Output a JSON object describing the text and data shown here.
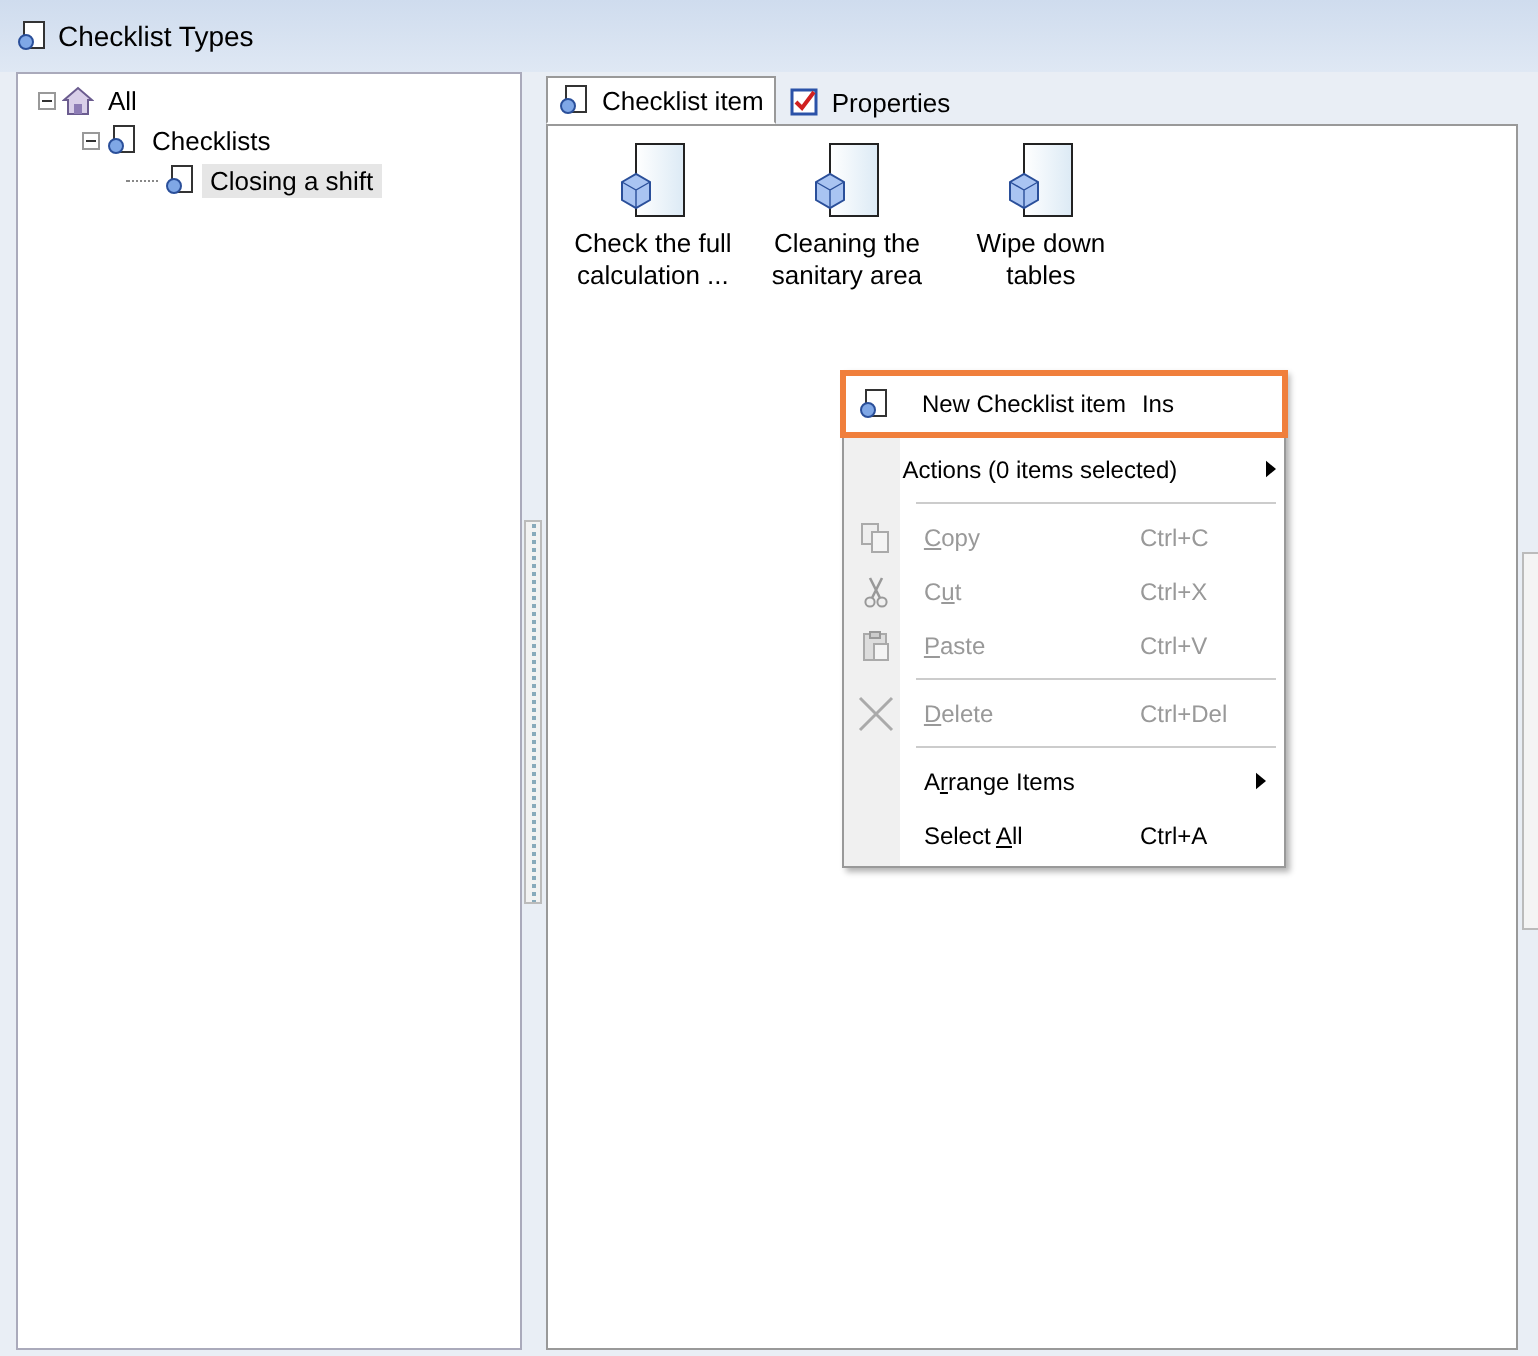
{
  "window": {
    "title": "Checklist Types"
  },
  "tree": [
    {
      "label": "All",
      "kind": "root",
      "selected": false,
      "expanded": true,
      "children": [
        {
          "label": "Checklists",
          "kind": "node",
          "selected": false,
          "expanded": true,
          "children": [
            {
              "label": "Closing a shift",
              "kind": "node",
              "selected": true
            }
          ]
        }
      ]
    }
  ],
  "tabs": [
    {
      "label": "Checklist item",
      "selected": true
    },
    {
      "label": "Properties",
      "selected": false
    }
  ],
  "items": [
    {
      "label": "Check the full calculation ..."
    },
    {
      "label": "Cleaning the sanitary area"
    },
    {
      "label": "Wipe down tables"
    }
  ],
  "context_menu": [
    {
      "kind": "item",
      "before": "New Checklist item",
      "shortcut": "Ins",
      "disabled": false,
      "submenu": false,
      "highlighted": true
    },
    {
      "kind": "item",
      "before": "Actions (0 items selected)",
      "disabled": false,
      "submenu": true,
      "highlighted": false
    },
    {
      "kind": "separator"
    },
    {
      "kind": "item",
      "key": "C",
      "after": "opy",
      "shortcut": "Ctrl+C",
      "disabled": true,
      "submenu": false,
      "highlighted": false
    },
    {
      "kind": "item",
      "before": "C",
      "key": "u",
      "after": "t",
      "shortcut": "Ctrl+X",
      "disabled": true,
      "submenu": false,
      "highlighted": false
    },
    {
      "kind": "item",
      "key": "P",
      "after": "aste",
      "shortcut": "Ctrl+V",
      "disabled": true,
      "submenu": false,
      "highlighted": false
    },
    {
      "kind": "separator"
    },
    {
      "kind": "item",
      "key": "D",
      "after": "elete",
      "shortcut": "Ctrl+Del",
      "disabled": true,
      "submenu": false,
      "highlighted": false
    },
    {
      "kind": "separator"
    },
    {
      "kind": "item",
      "before": "A",
      "key": "r",
      "after": "range Items",
      "disabled": false,
      "submenu": true,
      "highlighted": false
    },
    {
      "kind": "item",
      "before": "Select ",
      "key": "A",
      "after": "ll",
      "shortcut": "Ctrl+A",
      "disabled": false,
      "submenu": false,
      "highlighted": false
    }
  ]
}
